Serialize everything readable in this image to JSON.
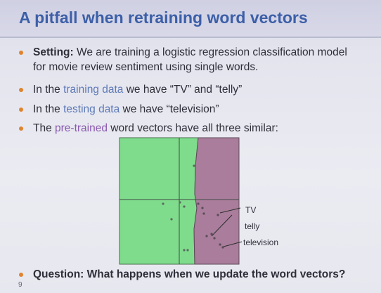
{
  "slide": {
    "title": "A pitfall when retraining word vectors",
    "bullets": [
      {
        "lead_bold": "Setting:",
        "text_line1": " We are training a logistic regression classification model",
        "text_line2": "for movie review sentiment using single words."
      },
      {
        "pre": "In the ",
        "highlight": "training data",
        "post": " we have “TV” and “telly”"
      },
      {
        "pre": "In the ",
        "highlight": "testing data",
        "post": " we have “television”"
      },
      {
        "pre": "The ",
        "highlight": "pre-trained",
        "post": " word vectors have all three similar:"
      }
    ],
    "question": "Question: What happens when we update the word vectors?",
    "slide_number": "9"
  },
  "plot": {
    "region_colors": {
      "left": "#7fdc8c",
      "right": "#a97d9b"
    },
    "word_labels": [
      "TV",
      "telly",
      "television"
    ]
  },
  "colors": {
    "title": "#3c5fa8",
    "bullet_dot": "#e0842c",
    "training_highlight": "#5d7ab6",
    "testing_highlight": "#5d7ab6",
    "pretrained_highlight": "#8a5bb0"
  }
}
